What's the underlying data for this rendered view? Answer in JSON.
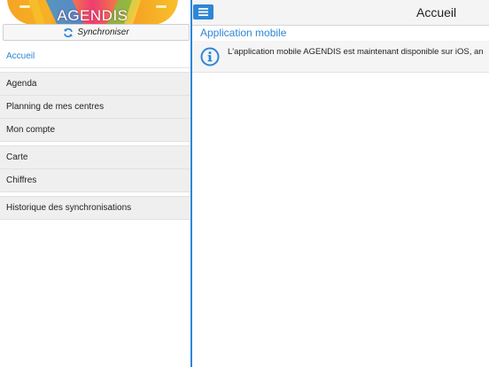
{
  "app": {
    "logo_text": "AGENDIS",
    "sync_label": "Synchroniser"
  },
  "sidebar": {
    "items": [
      {
        "label": "Accueil",
        "active": true
      },
      {
        "label": "Agenda"
      },
      {
        "label": "Planning de mes centres"
      },
      {
        "label": "Mon compte"
      },
      {
        "label": "Carte"
      },
      {
        "label": "Chiffres"
      },
      {
        "label": "Historique des synchronisations"
      }
    ]
  },
  "header": {
    "title": "Accueil",
    "menu_icon": "hamburger-icon"
  },
  "main": {
    "section_title": "Application mobile",
    "info_icon": "info-circle-icon",
    "info_text": "L'application mobile AGENDIS est maintenant disponible sur iOS, an"
  },
  "colors": {
    "accent": "#2e86d6",
    "sidebar_item_bg": "#efefef",
    "header_bg": "#f4f4f4"
  }
}
